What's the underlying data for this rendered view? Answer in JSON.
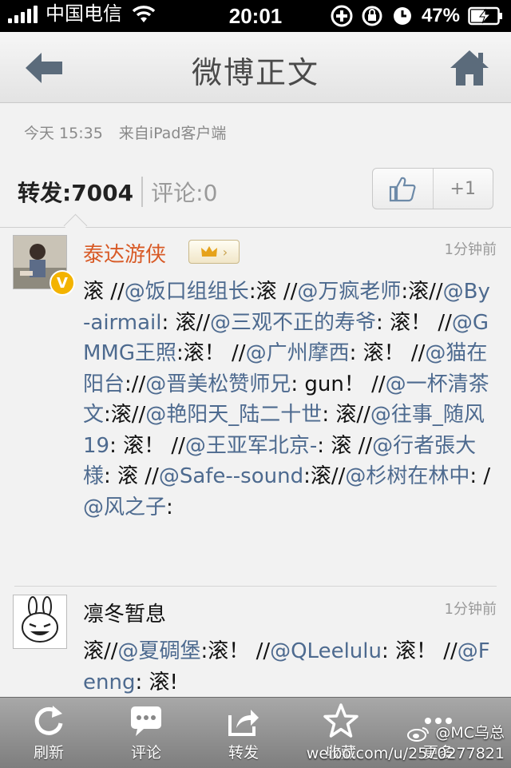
{
  "status_bar": {
    "carrier": "中国电信",
    "time": "20:01",
    "battery": "47%"
  },
  "nav": {
    "title": "微博正文",
    "icons": [
      "back-arrow-icon",
      "home-icon"
    ]
  },
  "post": {
    "time": "今天 15:35",
    "source": "来自iPad客户端",
    "repost_label": "转发:",
    "repost_count": "7004",
    "comment_label": "评论:",
    "comment_count": "0",
    "like_plus": "+1"
  },
  "reposts": [
    {
      "username": "泰达游侠",
      "time_ago": "1分钟前",
      "verified": true,
      "vip": true,
      "segments": [
        {
          "t": "滚 //"
        },
        {
          "t": "@饭口组组长",
          "at": true
        },
        {
          "t": ":滚 //"
        },
        {
          "t": "@万疯老师",
          "at": true
        },
        {
          "t": ":滚//"
        },
        {
          "t": "@By-airmail",
          "at": true
        },
        {
          "t": ": 滚//"
        },
        {
          "t": "@三观不正的寿爷",
          "at": true
        },
        {
          "t": ": 滚！ //"
        },
        {
          "t": "@GMMG王照",
          "at": true
        },
        {
          "t": ":滚！ //"
        },
        {
          "t": "@广州摩西",
          "at": true
        },
        {
          "t": ": 滚！ //"
        },
        {
          "t": "@猫在阳台",
          "at": true
        },
        {
          "t": "://"
        },
        {
          "t": "@晋美松赞师兄",
          "at": true
        },
        {
          "t": ": gun！ //"
        },
        {
          "t": "@一杯清茶文",
          "at": true
        },
        {
          "t": ":滚//"
        },
        {
          "t": "@艳阳天_陆二十世",
          "at": true
        },
        {
          "t": ": 滚//"
        },
        {
          "t": "@往事_随风19",
          "at": true
        },
        {
          "t": ": 滚！ //"
        },
        {
          "t": "@王亚军北京-",
          "at": true
        },
        {
          "t": ": 滚 //"
        },
        {
          "t": "@行者張大様",
          "at": true
        },
        {
          "t": ": 滚 //"
        },
        {
          "t": "@Safe--sound",
          "at": true
        },
        {
          "t": ":滚//"
        },
        {
          "t": "@杉树在林中",
          "at": true
        },
        {
          "t": ": /"
        },
        {
          "t": "@风之子",
          "at": true
        },
        {
          "t": ":"
        }
      ]
    },
    {
      "username": "凛冬暂息",
      "time_ago": "1分钟前",
      "verified": false,
      "vip": false,
      "segments": [
        {
          "t": "滚//"
        },
        {
          "t": "@夏碉堡",
          "at": true
        },
        {
          "t": ":滚！ //"
        },
        {
          "t": "@QLeelulu",
          "at": true
        },
        {
          "t": ": 滚！ //"
        },
        {
          "t": "@Fenng",
          "at": true
        },
        {
          "t": ": 滚!"
        }
      ]
    }
  ],
  "tabbar": {
    "items": [
      {
        "label": "刷新",
        "icon": "refresh-icon"
      },
      {
        "label": "评论",
        "icon": "comment-icon"
      },
      {
        "label": "转发",
        "icon": "repost-icon"
      },
      {
        "label": "收藏",
        "icon": "star-icon"
      },
      {
        "label": "更多",
        "icon": "more-icon"
      }
    ]
  },
  "watermark": {
    "handle": "@MC乌总",
    "url": "weibo.com/u/2570277821"
  },
  "colors": {
    "accent_name": "#d85a26",
    "mention": "#4d6a8f"
  }
}
